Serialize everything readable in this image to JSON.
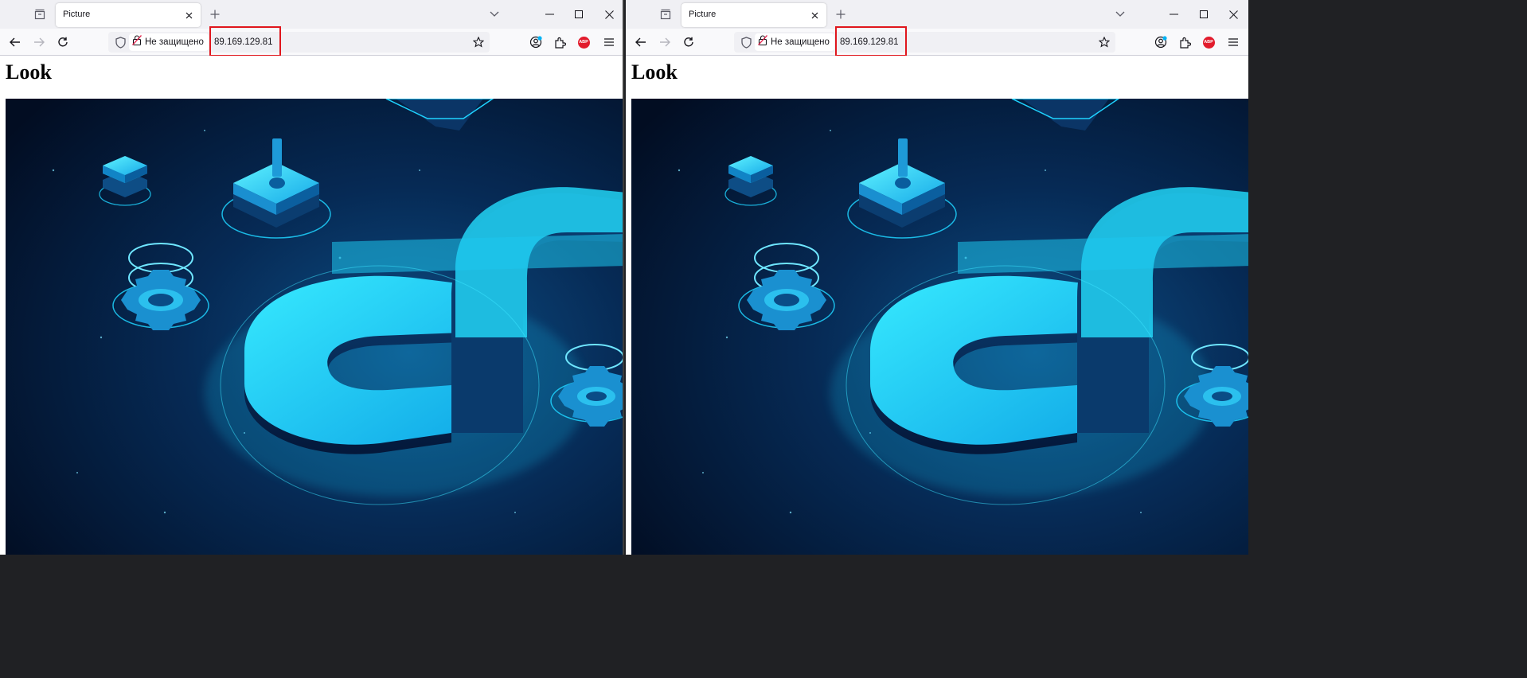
{
  "windows": [
    {
      "id": "left",
      "tab": {
        "title": "Picture"
      },
      "address": {
        "security_label": "Не защищено",
        "url": "89.169.129.81"
      },
      "toolbar": {
        "abp_badge": "ABP"
      },
      "page": {
        "heading": "Look"
      }
    },
    {
      "id": "right",
      "tab": {
        "title": "Picture"
      },
      "address": {
        "security_label": "Не защищено",
        "url": "89.169.129.81"
      },
      "toolbar": {
        "abp_badge": "ABP"
      },
      "page": {
        "heading": "Look"
      }
    }
  ],
  "icons": [
    "tab-list-icon",
    "close-tab-icon",
    "new-tab-icon",
    "list-all-tabs-icon",
    "minimize-icon",
    "maximize-icon",
    "close-window-icon",
    "back-icon",
    "forward-icon",
    "reload-icon",
    "shield-icon",
    "insecure-lock-icon",
    "bookmark-star-icon",
    "account-icon",
    "extensions-icon",
    "adblock-icon",
    "menu-icon"
  ],
  "colors": {
    "highlight": "#e0161d",
    "abp": "#e21b2c",
    "image_glow": "#19d3ff",
    "image_bg": "#03122b"
  }
}
